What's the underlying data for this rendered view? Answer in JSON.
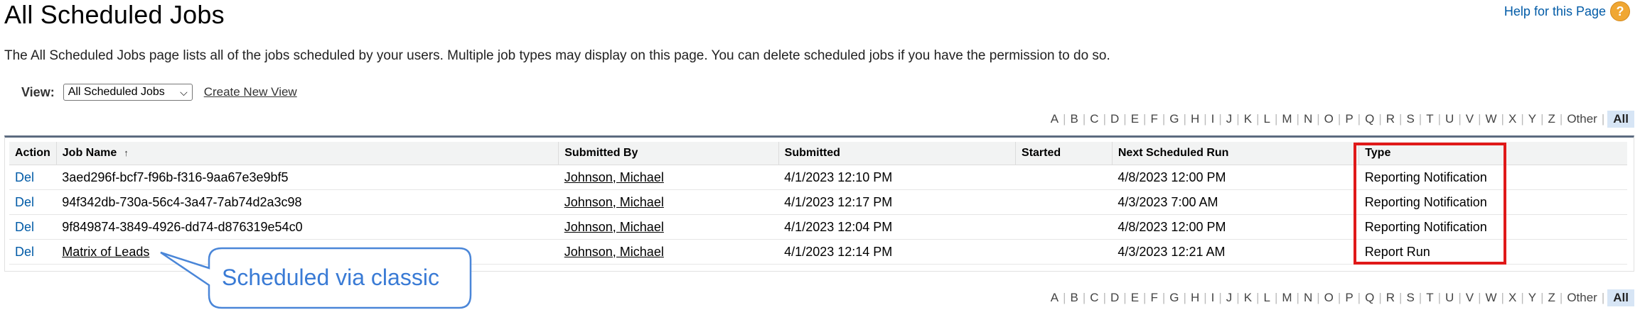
{
  "page": {
    "title": "All Scheduled Jobs",
    "help_text": "Help for this Page",
    "help_icon": "question-circle-icon",
    "description": "The All Scheduled Jobs page lists all of the jobs scheduled by your users. Multiple job types may display on this page. You can delete scheduled jobs if you have the permission to do so."
  },
  "view": {
    "label": "View:",
    "selected": "All Scheduled Jobs",
    "create_link": "Create New View"
  },
  "alpha_filter": {
    "letters": [
      "A",
      "B",
      "C",
      "D",
      "E",
      "F",
      "G",
      "H",
      "I",
      "J",
      "K",
      "L",
      "M",
      "N",
      "O",
      "P",
      "Q",
      "R",
      "S",
      "T",
      "U",
      "V",
      "W",
      "X",
      "Y",
      "Z",
      "Other"
    ],
    "all_label": "All"
  },
  "table": {
    "headers": {
      "action": "Action",
      "job_name": "Job Name",
      "submitted_by": "Submitted By",
      "submitted": "Submitted",
      "started": "Started",
      "next_run": "Next Scheduled Run",
      "type": "Type"
    },
    "rows": [
      {
        "action": "Del",
        "job_name": "3aed296f-bcf7-f96b-f316-9aa67e3e9bf5",
        "submitted_by": "Johnson, Michael",
        "submitted": "4/1/2023 12:10 PM",
        "started": "",
        "next_run": "4/8/2023 12:00 PM",
        "type": "Reporting Notification"
      },
      {
        "action": "Del",
        "job_name": "94f342db-730a-56c4-3a47-7ab74d2a3c98",
        "submitted_by": "Johnson, Michael",
        "submitted": "4/1/2023 12:17 PM",
        "started": "",
        "next_run": "4/3/2023 7:00 AM",
        "type": "Reporting Notification"
      },
      {
        "action": "Del",
        "job_name": "9f849874-3849-4926-dd74-d876319e54c0",
        "submitted_by": "Johnson, Michael",
        "submitted": "4/1/2023 12:04 PM",
        "started": "",
        "next_run": "4/8/2023 12:00 PM",
        "type": "Reporting Notification"
      },
      {
        "action": "Del",
        "job_name": "Matrix of Leads",
        "submitted_by": "Johnson, Michael",
        "submitted": "4/1/2023 12:14 PM",
        "started": "",
        "next_run": "4/3/2023 12:21 AM",
        "type": "Report Run"
      }
    ]
  },
  "annotation": {
    "callout_text": "Scheduled via classic",
    "highlight_color": "#e01919",
    "callout_color": "#3a7bd5"
  }
}
